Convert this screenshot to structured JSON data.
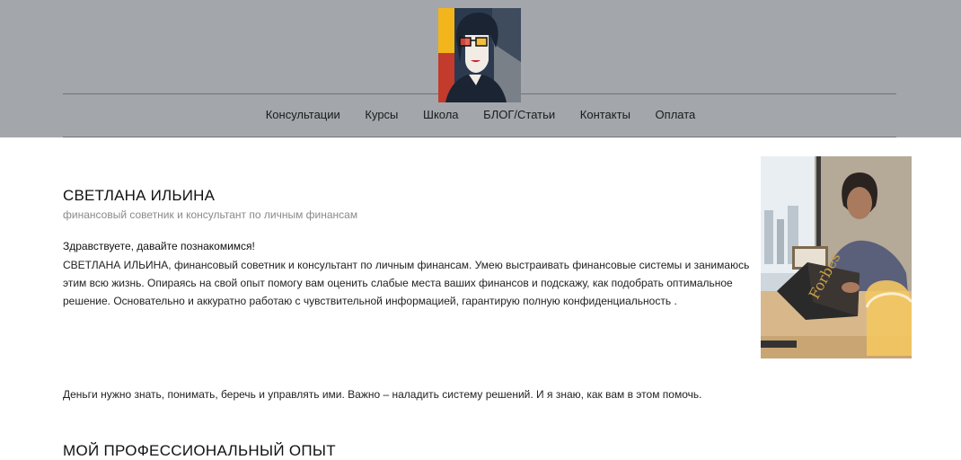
{
  "header": {
    "logo_icon": "woman-portrait-logo",
    "nav": [
      {
        "label": "Консультации"
      },
      {
        "label": "Курсы"
      },
      {
        "label": "Школа"
      },
      {
        "label": "БЛОГ/Статьи"
      },
      {
        "label": "Контакты"
      },
      {
        "label": "Оплата"
      }
    ],
    "bg_color": "#a3a7ac"
  },
  "intro": {
    "name": "СВЕТЛАНА ИЛЬИНА",
    "subtitle": "финансовый советник и консультант по личным финансам",
    "greeting": "Здравствуете, давайте познакомимся!",
    "paragraph": "СВЕТЛАНА ИЛЬИНА, финансовый советник и консультант по личным финансам. Умею выстраивать финансовые системы и занимаюсь этим всю жизнь. Опираясь на свой опыт помогу вам оценить слабые места ваших финансов и подскажу, как подобрать оптимальное решение. Основательно и аккуратно работаю с чувствительной информацией, гарантирую полную конфиденциальность .",
    "photo_icon": "portrait-photo-reading-forbes",
    "photo_magazine_text": "Forbes"
  },
  "quote": "Деньги нужно знать, понимать, беречь и управлять ими. Важно – наладить систему решений. И я знаю, как вам в этом помочь.",
  "section_heading": "МОЙ ПРОФЕССИОНАЛЬНЫЙ ОПЫТ"
}
